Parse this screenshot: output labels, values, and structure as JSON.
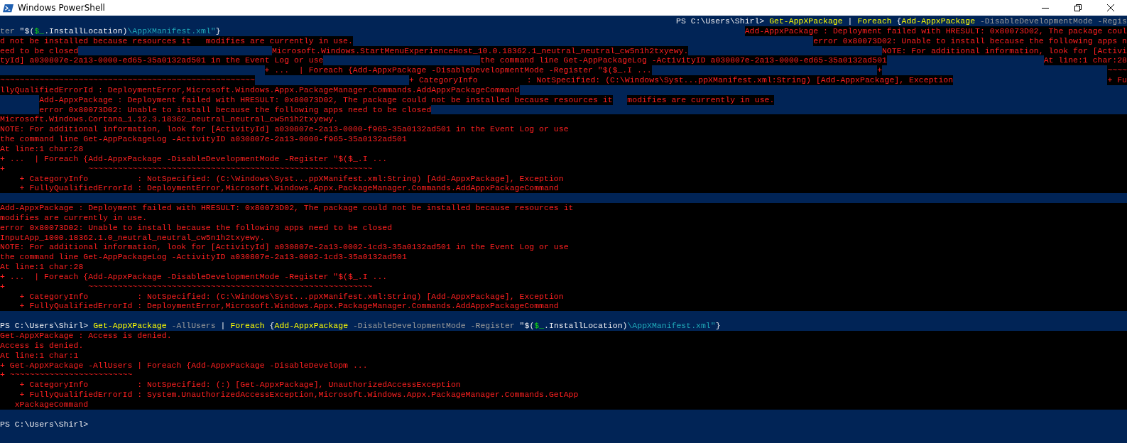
{
  "window": {
    "title": "Windows PowerShell"
  },
  "console": {
    "rows": [
      {
        "error_background": false,
        "kind": "right",
        "parts": [
          [
            {
              "t": "PS C:\\Users\\Shirl> ",
              "kind": "plain"
            },
            {
              "t": "Get-AppXPackage",
              "kind": "command"
            },
            {
              "t": " | ",
              "kind": "plain"
            },
            {
              "t": "Foreach",
              "kind": "command"
            },
            {
              "t": " {",
              "kind": "plain"
            },
            {
              "t": "Add-AppxPackage",
              "kind": "command"
            },
            {
              "t": " -DisableDevelopmentMode -Regis",
              "kind": "parameter"
            }
          ]
        ]
      },
      {
        "error_background": false,
        "kind": "spread",
        "parts": [
          [
            {
              "t": "ter ",
              "kind": "parameter"
            },
            {
              "t": "\"$(",
              "kind": "plain"
            },
            {
              "t": "$_",
              "kind": "variable"
            },
            {
              "t": ".InstallLocation)",
              "kind": "plain"
            },
            {
              "t": "\\AppXManifest.xml\"",
              "kind": "string"
            },
            {
              "t": "}",
              "kind": "plain"
            }
          ],
          [
            {
              "t": "Add-AppxPackage : Deployment failed with HRESULT: 0x80073D02, The package coul",
              "kind": "error"
            }
          ]
        ]
      },
      {
        "error_background": false,
        "kind": "spread",
        "parts": [
          [
            {
              "t": "d not be installed because resources it   modifies are currently in use.",
              "kind": "error"
            }
          ],
          [
            {
              "t": "error 0x80073D02: Unable to install because the following apps n",
              "kind": "error"
            }
          ]
        ]
      },
      {
        "error_background": false,
        "kind": "spread",
        "parts": [
          [
            {
              "t": "eed to be closed",
              "kind": "error"
            }
          ],
          [
            {
              "t": "Microsoft.Windows.StartMenuExperienceHost_10.0.18362.1_neutral_neutral_cw5n1h2txyewy.",
              "kind": "error"
            }
          ],
          [
            {
              "t": "NOTE: For additional information, look for [Activi",
              "kind": "error"
            }
          ]
        ]
      },
      {
        "error_background": false,
        "kind": "spread",
        "parts": [
          [
            {
              "t": "tyId] a030807e-2a13-0000-ed65-35a0132ad501 in the Event Log or use",
              "kind": "error"
            }
          ],
          [
            {
              "t": "the command line Get-AppPackageLog -ActivityID a030807e-2a13-0000-ed65-35a0132ad501",
              "kind": "error"
            }
          ],
          [
            {
              "t": "At line:1 char:28",
              "kind": "error"
            }
          ]
        ]
      },
      {
        "error_background": false,
        "kind": "spread",
        "lead_gap": true,
        "parts": [
          [
            {
              "t": "+ ...  | Foreach {Add-AppxPackage -DisableDevelopmentMode -Register \"$($_.I ...",
              "kind": "error"
            }
          ],
          [
            {
              "t": "+",
              "kind": "error"
            }
          ],
          [
            {
              "t": "~~~~",
              "kind": "error"
            }
          ]
        ]
      },
      {
        "error_background": false,
        "kind": "spread",
        "parts": [
          [
            {
              "t": "~~~~~~~~~~~~~~~~~~~~~~~~~~~~~~~~~~~~~~~~~~~~~~~~~~~~",
              "kind": "error"
            }
          ],
          [
            {
              "t": "+ CategoryInfo          : NotSpecified: (C:\\Windows\\Syst...ppXManifest.xml:String) [Add-AppxPackage], Exception",
              "kind": "error"
            }
          ],
          [
            {
              "t": "+ Fu",
              "kind": "error"
            }
          ]
        ]
      },
      {
        "error_background": false,
        "kind": "flow",
        "parts": [
          [
            {
              "t": "llyQualifiedErrorId : DeploymentError,Microsoft.Windows.Appx.PackageManager.Commands.AddAppxPackageCommand",
              "kind": "error"
            }
          ]
        ]
      },
      {
        "error_background": false,
        "kind": "flow",
        "lead_gap": true,
        "parts": [
          [
            {
              "t": "Add-AppxPackage : Deployment failed with HRESULT: 0x80073D02, The package could not be installed because resources it",
              "kind": "error"
            }
          ],
          [
            {
              "t": "modifies are currently in use.",
              "kind": "error"
            }
          ]
        ]
      },
      {
        "error_background": false,
        "kind": "flow",
        "lead_gap": true,
        "parts": [
          [
            {
              "t": "error 0x80073D02: Unable to install because the following apps need to be closed",
              "kind": "error"
            }
          ]
        ]
      },
      {
        "error_background": true,
        "kind": "flow",
        "parts": [
          [
            {
              "t": "Microsoft.Windows.Cortana_1.12.3.18362_neutral_neutral_cw5n1h2txyewy.",
              "kind": "error"
            }
          ]
        ]
      },
      {
        "error_background": true,
        "kind": "flow",
        "parts": [
          [
            {
              "t": "NOTE: For additional information, look for [ActivityId] a030807e-2a13-0000-f965-35a0132ad501 in the Event Log or use",
              "kind": "error"
            }
          ]
        ]
      },
      {
        "error_background": true,
        "kind": "flow",
        "parts": [
          [
            {
              "t": "the command line Get-AppPackageLog -ActivityID a030807e-2a13-0000-f965-35a0132ad501",
              "kind": "error"
            }
          ]
        ]
      },
      {
        "error_background": true,
        "kind": "flow",
        "parts": [
          [
            {
              "t": "At line:1 char:28",
              "kind": "error"
            }
          ]
        ]
      },
      {
        "error_background": true,
        "kind": "flow",
        "parts": [
          [
            {
              "t": "+ ...  | Foreach {Add-AppxPackage -DisableDevelopmentMode -Register \"$($_.I ...",
              "kind": "error"
            }
          ]
        ]
      },
      {
        "error_background": true,
        "kind": "flow",
        "parts": [
          [
            {
              "t": "+                 ~~~~~~~~~~~~~~~~~~~~~~~~~~~~~~~~~~~~~~~~~~~~~~~~~~~~~~~~~~",
              "kind": "error"
            }
          ]
        ]
      },
      {
        "error_background": true,
        "kind": "flow",
        "parts": [
          [
            {
              "t": "    + CategoryInfo          : NotSpecified: (C:\\Windows\\Syst...ppXManifest.xml:String) [Add-AppxPackage], Exception",
              "kind": "error"
            }
          ]
        ]
      },
      {
        "error_background": true,
        "kind": "flow",
        "parts": [
          [
            {
              "t": "    + FullyQualifiedErrorId : DeploymentError,Microsoft.Windows.Appx.PackageManager.Commands.AddAppxPackageCommand",
              "kind": "error"
            }
          ]
        ]
      },
      {
        "error_background": true,
        "kind": "flow",
        "blank_before": true,
        "parts": [
          [
            {
              "t": "Add-AppxPackage : Deployment failed with HRESULT: 0x80073D02, The package could not be installed because resources it",
              "kind": "error"
            }
          ]
        ]
      },
      {
        "error_background": true,
        "kind": "flow",
        "parts": [
          [
            {
              "t": "modifies are currently in use.",
              "kind": "error"
            }
          ]
        ]
      },
      {
        "error_background": true,
        "kind": "flow",
        "parts": [
          [
            {
              "t": "error 0x80073D02: Unable to install because the following apps need to be closed",
              "kind": "error"
            }
          ]
        ]
      },
      {
        "error_background": true,
        "kind": "flow",
        "parts": [
          [
            {
              "t": "InputApp_1000.18362.1.0_neutral_neutral_cw5n1h2txyewy.",
              "kind": "error"
            }
          ]
        ]
      },
      {
        "error_background": true,
        "kind": "flow",
        "parts": [
          [
            {
              "t": "NOTE: For additional information, look for [ActivityId] a030807e-2a13-0002-1cd3-35a0132ad501 in the Event Log or use",
              "kind": "error"
            }
          ]
        ]
      },
      {
        "error_background": true,
        "kind": "flow",
        "parts": [
          [
            {
              "t": "the command line Get-AppPackageLog -ActivityID a030807e-2a13-0002-1cd3-35a0132ad501",
              "kind": "error"
            }
          ]
        ]
      },
      {
        "error_background": true,
        "kind": "flow",
        "parts": [
          [
            {
              "t": "At line:1 char:28",
              "kind": "error"
            }
          ]
        ]
      },
      {
        "error_background": true,
        "kind": "flow",
        "parts": [
          [
            {
              "t": "+ ...  | Foreach {Add-AppxPackage -DisableDevelopmentMode -Register \"$($_.I ...",
              "kind": "error"
            }
          ]
        ]
      },
      {
        "error_background": true,
        "kind": "flow",
        "parts": [
          [
            {
              "t": "+                 ~~~~~~~~~~~~~~~~~~~~~~~~~~~~~~~~~~~~~~~~~~~~~~~~~~~~~~~~~~",
              "kind": "error"
            }
          ]
        ]
      },
      {
        "error_background": true,
        "kind": "flow",
        "parts": [
          [
            {
              "t": "    + CategoryInfo          : NotSpecified: (C:\\Windows\\Syst...ppXManifest.xml:String) [Add-AppxPackage], Exception",
              "kind": "error"
            }
          ]
        ]
      },
      {
        "error_background": true,
        "kind": "flow",
        "parts": [
          [
            {
              "t": "    + FullyQualifiedErrorId : DeploymentError,Microsoft.Windows.Appx.PackageManager.Commands.AddAppxPackageCommand",
              "kind": "error"
            }
          ]
        ]
      },
      {
        "error_background": false,
        "kind": "flow",
        "blank_before": true,
        "parts": [
          [
            {
              "t": "PS C:\\Users\\Shirl> ",
              "kind": "plain"
            },
            {
              "t": "Get-AppXPackage",
              "kind": "command"
            },
            {
              "t": " -AllUsers",
              "kind": "parameter"
            },
            {
              "t": " | ",
              "kind": "plain"
            },
            {
              "t": "Foreach",
              "kind": "command"
            },
            {
              "t": " {",
              "kind": "plain"
            },
            {
              "t": "Add-AppxPackage",
              "kind": "command"
            },
            {
              "t": " -DisableDevelopmentMode -Register",
              "kind": "parameter"
            },
            {
              "t": " \"$(",
              "kind": "plain"
            },
            {
              "t": "$_",
              "kind": "variable"
            },
            {
              "t": ".InstallLocation)",
              "kind": "plain"
            },
            {
              "t": "\\AppXManifest.xml\"",
              "kind": "string"
            },
            {
              "t": "}",
              "kind": "plain"
            }
          ]
        ]
      },
      {
        "error_background": true,
        "kind": "flow",
        "parts": [
          [
            {
              "t": "Get-AppXPackage : Access is denied.",
              "kind": "error"
            }
          ]
        ]
      },
      {
        "error_background": true,
        "kind": "flow",
        "parts": [
          [
            {
              "t": "Access is denied.",
              "kind": "error"
            }
          ]
        ]
      },
      {
        "error_background": true,
        "kind": "flow",
        "parts": [
          [
            {
              "t": "At line:1 char:1",
              "kind": "error"
            }
          ]
        ]
      },
      {
        "error_background": true,
        "kind": "flow",
        "parts": [
          [
            {
              "t": "+ Get-AppXPackage -AllUsers | Foreach {Add-AppxPackage -DisableDevelopm ...",
              "kind": "error"
            }
          ]
        ]
      },
      {
        "error_background": true,
        "kind": "flow",
        "parts": [
          [
            {
              "t": "+ ~~~~~~~~~~~~~~~~~~~~~~~~~",
              "kind": "error"
            }
          ]
        ]
      },
      {
        "error_background": true,
        "kind": "flow",
        "parts": [
          [
            {
              "t": "    + CategoryInfo          : NotSpecified: (:) [Get-AppxPackage], UnauthorizedAccessException",
              "kind": "error"
            }
          ]
        ]
      },
      {
        "error_background": true,
        "kind": "flow",
        "parts": [
          [
            {
              "t": "    + FullyQualifiedErrorId : System.UnauthorizedAccessException,Microsoft.Windows.Appx.PackageManager.Commands.GetApp",
              "kind": "error"
            }
          ]
        ]
      },
      {
        "error_background": true,
        "kind": "flow",
        "parts": [
          [
            {
              "t": "   xPackageCommand",
              "kind": "error"
            }
          ]
        ]
      },
      {
        "error_background": false,
        "kind": "flow",
        "blank_before": true,
        "parts": [
          [
            {
              "t": "PS C:\\Users\\Shirl>",
              "kind": "plain"
            }
          ]
        ]
      }
    ]
  }
}
